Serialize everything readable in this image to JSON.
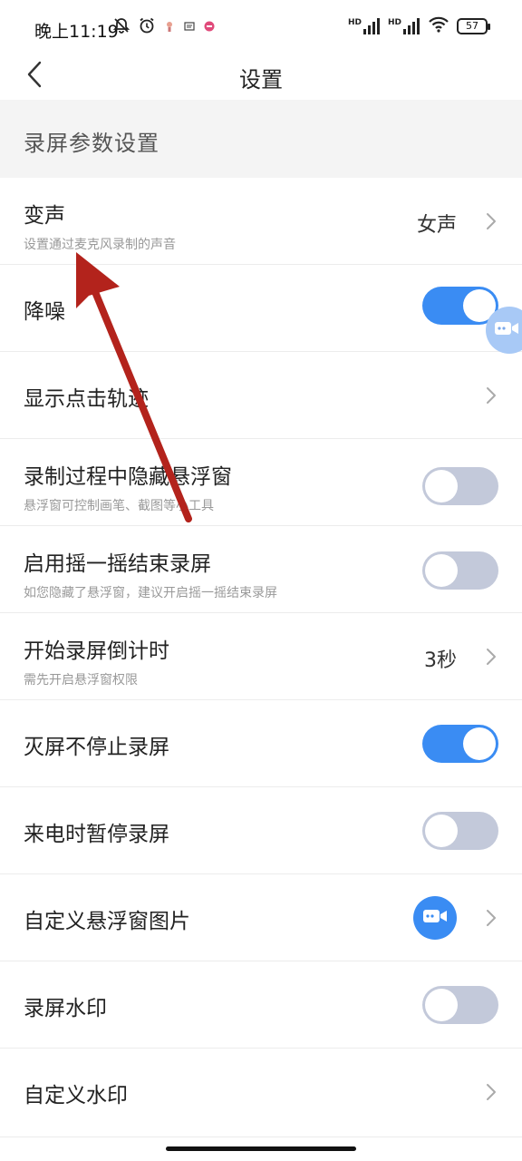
{
  "status_bar": {
    "time": "晚上11:19",
    "battery": "57",
    "hd_label": "HD"
  },
  "header": {
    "title": "设置"
  },
  "section": {
    "title": "录屏参数设置"
  },
  "settings": [
    {
      "label": "变声",
      "subtitle": "设置通过麦克风录制的声音",
      "value": "女声",
      "control": "chevron"
    },
    {
      "label": "降噪",
      "subtitle": "",
      "control": "toggle",
      "on": true
    },
    {
      "label": "显示点击轨迹",
      "subtitle": "",
      "control": "chevron"
    },
    {
      "label": "录制过程中隐藏悬浮窗",
      "subtitle": "悬浮窗可控制画笔、截图等小工具",
      "control": "toggle",
      "on": false
    },
    {
      "label": "启用摇一摇结束录屏",
      "subtitle": "如您隐藏了悬浮窗，建议开启摇一摇结束录屏",
      "control": "toggle",
      "on": false
    },
    {
      "label": "开始录屏倒计时",
      "subtitle": "需先开启悬浮窗权限",
      "value": "3秒",
      "control": "chevron"
    },
    {
      "label": "灭屏不停止录屏",
      "subtitle": "",
      "control": "toggle",
      "on": true
    },
    {
      "label": "来电时暂停录屏",
      "subtitle": "",
      "control": "toggle",
      "on": false
    },
    {
      "label": "自定义悬浮窗图片",
      "subtitle": "",
      "control": "image-chevron"
    },
    {
      "label": "录屏水印",
      "subtitle": "",
      "control": "toggle",
      "on": false
    },
    {
      "label": "自定义水印",
      "subtitle": "",
      "control": "chevron"
    }
  ],
  "icons": {
    "back": "chevron-left-icon",
    "chevron": "chevron-right-icon",
    "camera": "video-camera-icon",
    "mute": "bell-off-icon",
    "alarm": "alarm-icon",
    "wifi": "wifi-icon",
    "signal": "signal-icon"
  },
  "colors": {
    "accent": "#3a8cf3",
    "toggle_off": "#c3c9da",
    "section_bg": "#f4f4f4",
    "annotation_arrow": "#b3231c"
  }
}
